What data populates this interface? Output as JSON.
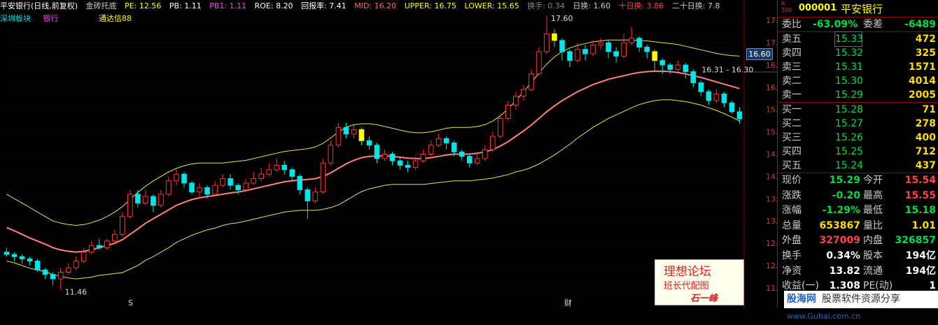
{
  "header": {
    "stock": "平安银行(日线,前复权)",
    "indicator": "金砖托底",
    "pe": "PE: 12.56",
    "pb": "PB: 1.11",
    "pb1": "PB1: 1.11",
    "roe": "ROE: 8.20",
    "return_rate": "回报率: 7.41",
    "mid": "MID: 16.20",
    "upper": "UPPER: 16.75",
    "lower": "LOWER: 15.65",
    "turnover": "换手: 0.34",
    "day_turn": "日换: 1.60",
    "ten_turn": "十日换: 3.86",
    "twenty_turn": "二十日换: 7.8"
  },
  "subbar": {
    "sector": "深圳板块",
    "industry": "银行",
    "tdx": "通达信88"
  },
  "annotations": {
    "high": "17.60",
    "low": "11.46",
    "range": "16.31 - 16.30",
    "cur_price": "16.60",
    "marker_s": "S",
    "marker_cai": "财"
  },
  "chart_data": {
    "type": "candlestick",
    "ylim": [
      11.45,
      17.55
    ],
    "yticks": [
      "17.50",
      "17.00",
      "16.50",
      "16.00",
      "15.50",
      "15.00",
      "14.50",
      "14.00",
      "13.50",
      "13.00",
      "12.50",
      "12.00",
      "11.50"
    ],
    "candles": [
      [
        12.3,
        12.25,
        12.4,
        12.2
      ],
      [
        12.25,
        12.2,
        12.3,
        12.1
      ],
      [
        12.2,
        12.15,
        12.25,
        12.05
      ],
      [
        12.15,
        12.1,
        12.2,
        12.0
      ],
      [
        12.1,
        11.9,
        12.15,
        11.85
      ],
      [
        11.9,
        11.8,
        11.95,
        11.7
      ],
      [
        11.8,
        11.7,
        11.85,
        11.55
      ],
      [
        11.7,
        11.85,
        11.95,
        11.46
      ],
      [
        11.85,
        11.95,
        12.05,
        11.8
      ],
      [
        11.95,
        12.1,
        12.2,
        11.9
      ],
      [
        12.1,
        12.3,
        12.4,
        12.05
      ],
      [
        12.3,
        12.45,
        12.55,
        12.25
      ],
      [
        12.45,
        12.4,
        12.6,
        12.35
      ],
      [
        12.4,
        12.55,
        12.6,
        12.35
      ],
      [
        12.55,
        12.7,
        12.8,
        12.5
      ],
      [
        12.7,
        13.1,
        13.2,
        12.65
      ],
      [
        13.1,
        13.6,
        13.7,
        13.05
      ],
      [
        13.6,
        13.4,
        13.7,
        13.3
      ],
      [
        13.4,
        13.55,
        13.7,
        13.35
      ],
      [
        13.55,
        13.35,
        13.6,
        13.2
      ],
      [
        13.35,
        13.6,
        13.7,
        13.3
      ],
      [
        13.6,
        13.9,
        14.0,
        13.55
      ],
      [
        13.9,
        14.05,
        14.15,
        13.8
      ],
      [
        14.05,
        13.85,
        14.1,
        13.75
      ],
      [
        13.85,
        13.65,
        13.9,
        13.6
      ],
      [
        13.65,
        13.75,
        13.85,
        13.55
      ],
      [
        13.75,
        13.6,
        13.8,
        13.5
      ],
      [
        13.6,
        13.8,
        13.9,
        13.55
      ],
      [
        13.8,
        13.95,
        14.05,
        13.75
      ],
      [
        13.95,
        13.8,
        14.05,
        13.7
      ],
      [
        13.8,
        13.7,
        13.85,
        13.6
      ],
      [
        13.7,
        13.85,
        13.95,
        13.65
      ],
      [
        13.85,
        13.95,
        14.1,
        13.8
      ],
      [
        13.95,
        14.05,
        14.2,
        13.9
      ],
      [
        14.05,
        14.15,
        14.3,
        14.0
      ],
      [
        14.15,
        14.25,
        14.4,
        14.1
      ],
      [
        14.25,
        14.15,
        14.35,
        14.05
      ],
      [
        14.15,
        14.0,
        14.2,
        13.9
      ],
      [
        14.0,
        13.7,
        14.05,
        13.6
      ],
      [
        13.7,
        13.45,
        13.75,
        13.05
      ],
      [
        13.45,
        13.65,
        13.75,
        13.4
      ],
      [
        13.65,
        14.3,
        14.4,
        13.6
      ],
      [
        14.3,
        14.7,
        14.8,
        14.25
      ],
      [
        14.7,
        15.1,
        15.2,
        14.65
      ],
      [
        15.1,
        14.95,
        15.2,
        14.85
      ],
      [
        14.95,
        15.05,
        15.15,
        14.85
      ],
      [
        15.05,
        14.8,
        15.1,
        14.7
      ],
      [
        14.8,
        14.7,
        14.9,
        14.6
      ],
      [
        14.7,
        14.4,
        14.75,
        14.3
      ],
      [
        14.4,
        14.5,
        14.6,
        14.35
      ],
      [
        14.5,
        14.35,
        14.55,
        14.25
      ],
      [
        14.35,
        14.25,
        14.45,
        14.15
      ],
      [
        14.25,
        14.2,
        14.35,
        14.1
      ],
      [
        14.2,
        14.35,
        14.45,
        14.15
      ],
      [
        14.35,
        14.5,
        14.6,
        14.3
      ],
      [
        14.5,
        14.7,
        14.8,
        14.45
      ],
      [
        14.7,
        14.85,
        14.95,
        14.65
      ],
      [
        14.85,
        14.75,
        14.9,
        14.6
      ],
      [
        14.75,
        14.55,
        14.8,
        14.45
      ],
      [
        14.55,
        14.45,
        14.6,
        14.35
      ],
      [
        14.45,
        14.3,
        14.5,
        14.2
      ],
      [
        14.3,
        14.4,
        14.5,
        14.25
      ],
      [
        14.4,
        14.6,
        14.7,
        14.35
      ],
      [
        14.6,
        14.9,
        15.0,
        14.55
      ],
      [
        14.9,
        15.3,
        15.4,
        14.85
      ],
      [
        15.3,
        15.6,
        15.7,
        15.25
      ],
      [
        15.6,
        15.8,
        15.9,
        15.5
      ],
      [
        15.8,
        15.95,
        16.05,
        15.7
      ],
      [
        15.95,
        16.3,
        16.4,
        15.9
      ],
      [
        16.3,
        16.8,
        16.9,
        16.25
      ],
      [
        16.8,
        17.2,
        17.6,
        16.75
      ],
      [
        17.2,
        17.05,
        17.3,
        16.9
      ],
      [
        17.05,
        16.8,
        17.1,
        16.6
      ],
      [
        16.8,
        16.6,
        16.85,
        16.45
      ],
      [
        16.6,
        16.85,
        17.0,
        16.55
      ],
      [
        16.85,
        16.75,
        16.95,
        16.6
      ],
      [
        16.75,
        16.95,
        17.05,
        16.7
      ],
      [
        16.95,
        17.0,
        17.1,
        16.85
      ],
      [
        17.0,
        16.8,
        17.05,
        16.65
      ],
      [
        16.8,
        16.7,
        16.9,
        16.55
      ],
      [
        16.7,
        17.0,
        17.2,
        16.65
      ],
      [
        17.0,
        17.1,
        17.35,
        16.95
      ],
      [
        17.1,
        16.9,
        17.15,
        16.8
      ],
      [
        16.9,
        16.8,
        16.95,
        16.65
      ],
      [
        16.8,
        16.6,
        16.85,
        16.35
      ],
      [
        16.6,
        16.5,
        16.65,
        16.3
      ],
      [
        16.5,
        16.4,
        16.55,
        16.3
      ],
      [
        16.4,
        16.5,
        16.6,
        16.35
      ],
      [
        16.5,
        16.35,
        16.55,
        16.2
      ],
      [
        16.35,
        16.1,
        16.4,
        16.0
      ],
      [
        16.1,
        15.9,
        16.15,
        15.8
      ],
      [
        15.9,
        15.7,
        15.95,
        15.6
      ],
      [
        15.7,
        15.85,
        15.95,
        15.65
      ],
      [
        15.85,
        15.65,
        15.9,
        15.55
      ],
      [
        15.65,
        15.45,
        15.7,
        15.4
      ],
      [
        15.45,
        15.29,
        15.55,
        15.18
      ]
    ],
    "ma": [
      12.85,
      12.78,
      12.7,
      12.62,
      12.55,
      12.48,
      12.4,
      12.35,
      12.32,
      12.3,
      12.32,
      12.35,
      12.4,
      12.45,
      12.5,
      12.58,
      12.7,
      12.82,
      12.95,
      13.05,
      13.15,
      13.25,
      13.35,
      13.42,
      13.48,
      13.52,
      13.55,
      13.57,
      13.6,
      13.63,
      13.65,
      13.68,
      13.72,
      13.76,
      13.8,
      13.84,
      13.88,
      13.9,
      13.92,
      13.93,
      13.95,
      14.0,
      14.08,
      14.18,
      14.28,
      14.36,
      14.42,
      14.45,
      14.46,
      14.46,
      14.45,
      14.43,
      14.41,
      14.4,
      14.4,
      14.42,
      14.45,
      14.48,
      14.5,
      14.5,
      14.5,
      14.52,
      14.55,
      14.6,
      14.68,
      14.78,
      14.9,
      15.02,
      15.15,
      15.3,
      15.45,
      15.58,
      15.7,
      15.8,
      15.9,
      15.98,
      16.06,
      16.12,
      16.18,
      16.22,
      16.26,
      16.3,
      16.33,
      16.35,
      16.36,
      16.36,
      16.35,
      16.33,
      16.3,
      16.26,
      16.22,
      16.17,
      16.12,
      16.07,
      16.02,
      15.97
    ],
    "upper": [
      13.6,
      13.5,
      13.4,
      13.3,
      13.2,
      13.1,
      13.0,
      12.95,
      12.92,
      12.9,
      12.92,
      12.96,
      13.02,
      13.1,
      13.2,
      13.32,
      13.48,
      13.64,
      13.78,
      13.9,
      14.0,
      14.1,
      14.18,
      14.24,
      14.28,
      14.3,
      14.3,
      14.3,
      14.3,
      14.32,
      14.34,
      14.36,
      14.4,
      14.44,
      14.48,
      14.52,
      14.56,
      14.58,
      14.6,
      14.62,
      14.66,
      14.74,
      14.86,
      15.0,
      15.1,
      15.16,
      15.18,
      15.18,
      15.16,
      15.12,
      15.08,
      15.04,
      15.0,
      14.98,
      14.98,
      15.0,
      15.04,
      15.08,
      15.1,
      15.1,
      15.1,
      15.12,
      15.16,
      15.24,
      15.36,
      15.52,
      15.7,
      15.9,
      16.1,
      16.32,
      16.52,
      16.68,
      16.8,
      16.88,
      16.94,
      16.98,
      17.02,
      17.04,
      17.06,
      17.06,
      17.06,
      17.06,
      17.05,
      17.04,
      17.02,
      17.0,
      16.98,
      16.96,
      16.92,
      16.88,
      16.84,
      16.8,
      16.76,
      16.73,
      16.71,
      16.7
    ],
    "lower": [
      12.1,
      12.06,
      12.0,
      11.94,
      11.9,
      11.86,
      11.8,
      11.76,
      11.72,
      11.7,
      11.72,
      11.74,
      11.78,
      11.8,
      11.82,
      11.84,
      11.92,
      12.0,
      12.12,
      12.2,
      12.3,
      12.4,
      12.52,
      12.6,
      12.68,
      12.74,
      12.8,
      12.84,
      12.9,
      12.94,
      12.96,
      13.0,
      13.04,
      13.08,
      13.12,
      13.16,
      13.2,
      13.22,
      13.24,
      13.24,
      13.24,
      13.26,
      13.3,
      13.36,
      13.46,
      13.56,
      13.66,
      13.72,
      13.76,
      13.8,
      13.82,
      13.82,
      13.82,
      13.82,
      13.82,
      13.84,
      13.86,
      13.88,
      13.9,
      13.9,
      13.9,
      13.92,
      13.94,
      13.96,
      14.0,
      14.04,
      14.1,
      14.14,
      14.2,
      14.28,
      14.38,
      14.48,
      14.6,
      14.72,
      14.86,
      14.98,
      15.1,
      15.2,
      15.3,
      15.38,
      15.46,
      15.54,
      15.61,
      15.66,
      15.7,
      15.72,
      15.72,
      15.7,
      15.68,
      15.64,
      15.6,
      15.54,
      15.48,
      15.41,
      15.33,
      15.24
    ]
  },
  "panel": {
    "r_label": "R",
    "r_num": "300",
    "code": "000001",
    "name": "平安银行",
    "weibi_label": "委比",
    "weibi": "-63.09%",
    "weicha_label": "委差",
    "weicha": "-6489",
    "asks": [
      {
        "label": "卖五",
        "price": "15.33",
        "qty": "472"
      },
      {
        "label": "卖四",
        "price": "15.32",
        "qty": "325"
      },
      {
        "label": "卖三",
        "price": "15.31",
        "qty": "1571"
      },
      {
        "label": "卖二",
        "price": "15.30",
        "qty": "4014"
      },
      {
        "label": "卖一",
        "price": "15.29",
        "qty": "2005"
      }
    ],
    "bids": [
      {
        "label": "买一",
        "price": "15.28",
        "qty": "71"
      },
      {
        "label": "买二",
        "price": "15.27",
        "qty": "278"
      },
      {
        "label": "买三",
        "price": "15.26",
        "qty": "400"
      },
      {
        "label": "买四",
        "price": "15.25",
        "qty": "712"
      },
      {
        "label": "买五",
        "price": "15.24",
        "qty": "437"
      }
    ],
    "stats": [
      {
        "l1": "现价",
        "v1": "15.29",
        "c1": "#00dd44",
        "l2": "今开",
        "v2": "15.54",
        "c2": "#ff4444"
      },
      {
        "l1": "涨跌",
        "v1": "-0.20",
        "c1": "#00dd44",
        "l2": "最高",
        "v2": "15.55",
        "c2": "#ff4444"
      },
      {
        "l1": "涨幅",
        "v1": "-1.29%",
        "c1": "#00dd44",
        "l2": "最低",
        "v2": "15.18",
        "c2": "#00dd44"
      },
      {
        "l1": "总量",
        "v1": "653867",
        "c1": "#ffdd00",
        "l2": "量比",
        "v2": "1.01",
        "c2": "#ffdd00"
      },
      {
        "l1": "外盘",
        "v1": "327009",
        "c1": "#ff4444",
        "l2": "内盘",
        "v2": "326857",
        "c2": "#00dd44"
      },
      {
        "l1": "换手",
        "v1": "0.34%",
        "c1": "#ffffff",
        "l2": "股本",
        "v2": "194亿",
        "c2": "#ffffff"
      },
      {
        "l1": "净资",
        "v1": "13.82",
        "c1": "#ffffff",
        "l2": "流通",
        "v2": "194亿",
        "c2": "#ffffff"
      },
      {
        "l1": "收益(一)",
        "v1": "1.308",
        "c1": "#ffffff",
        "l2": "PE(动)",
        "v2": "1",
        "c2": "#ffffff"
      }
    ]
  },
  "watermark": {
    "line1": "理想论坛",
    "line2": "班长代配图",
    "line3": "石一峰"
  },
  "footer": {
    "site": "股海网",
    "slogan": "股票软件资源分享",
    "url": "www.Guhai.com.cn"
  },
  "colors": {
    "up": "#ff3333",
    "down": "#00e5e5",
    "mid": "#ff8080",
    "band": "#e6e64d",
    "yellow": "#ffff00"
  }
}
